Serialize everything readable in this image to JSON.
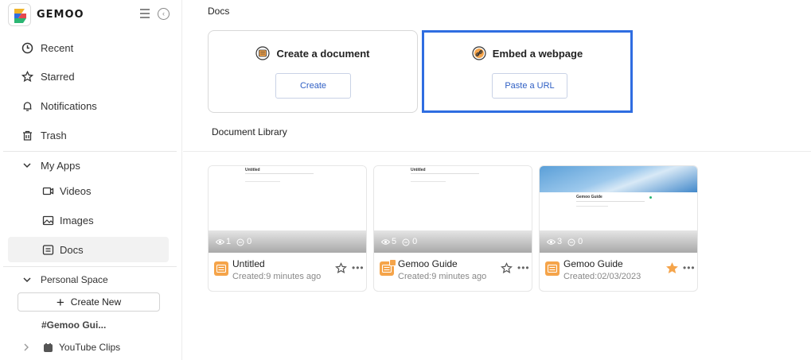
{
  "app": {
    "logo_text": "GEMOO"
  },
  "sidebar": {
    "items": [
      {
        "label": "Recent",
        "icon": "clock-icon"
      },
      {
        "label": "Starred",
        "icon": "star-icon"
      },
      {
        "label": "Notifications",
        "icon": "bell-icon"
      },
      {
        "label": "Trash",
        "icon": "trash-icon"
      }
    ],
    "my_apps": {
      "label": "My Apps",
      "items": [
        {
          "label": "Videos",
          "icon": "video-icon"
        },
        {
          "label": "Images",
          "icon": "image-icon"
        },
        {
          "label": "Docs",
          "icon": "doc-icon"
        }
      ]
    },
    "personal_space": {
      "label": "Personal Space",
      "create_new": "Create New",
      "items": [
        {
          "label": "#Gemoo Gui..."
        },
        {
          "label": "YouTube Clips"
        }
      ]
    }
  },
  "main": {
    "title": "Docs",
    "create_card": {
      "title": "Create a document",
      "button": "Create"
    },
    "embed_card": {
      "title": "Embed a webpage",
      "button": "Paste a URL"
    },
    "library_title": "Document Library",
    "documents": [
      {
        "name": "Untitled",
        "created": "Created:9 minutes ago",
        "views": "1",
        "comments": "0",
        "starred": false,
        "preview_title": "Untitled"
      },
      {
        "name": "Gemoo Guide",
        "created": "Created:9 minutes ago",
        "views": "5",
        "comments": "0",
        "starred": false,
        "preview_title": "Untitled"
      },
      {
        "name": "Gemoo Guide",
        "created": "Created:02/03/2023",
        "views": "3",
        "comments": "0",
        "starred": true,
        "preview_title": "Gemoo Guide"
      }
    ]
  },
  "colors": {
    "accent_blue": "#2f6de1",
    "doc_icon_orange": "#f5a44a",
    "star_filled": "#f5a44a"
  }
}
